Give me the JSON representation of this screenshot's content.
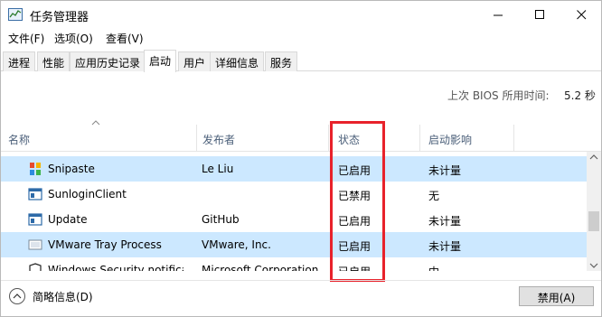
{
  "window": {
    "title": "任务管理器"
  },
  "menubar": [
    {
      "label": "文件(F)"
    },
    {
      "label": "选项(O)"
    },
    {
      "label": "查看(V)"
    }
  ],
  "tabs": [
    {
      "label": "进程"
    },
    {
      "label": "性能"
    },
    {
      "label": "应用历史记录"
    },
    {
      "label": "启动",
      "active": true
    },
    {
      "label": "用户"
    },
    {
      "label": "详细信息"
    },
    {
      "label": "服务"
    }
  ],
  "bios": {
    "label": "上次 BIOS 所用时间:",
    "value": "5.2 秒"
  },
  "columns": {
    "name": "名称",
    "publisher": "发布者",
    "status": "状态",
    "impact": "启动影响"
  },
  "rows": [
    {
      "name": "Snipaste",
      "publisher": "Le Liu",
      "status": "已启用",
      "impact": "未计量",
      "icon": "snipaste-icon",
      "selected": true
    },
    {
      "name": "SunloginClient",
      "publisher": "",
      "status": "已禁用",
      "impact": "无",
      "icon": "app-window-icon",
      "selected": false
    },
    {
      "name": "Update",
      "publisher": "GitHub",
      "status": "已启用",
      "impact": "未计量",
      "icon": "app-window-icon",
      "selected": false
    },
    {
      "name": "VMware Tray Process",
      "publisher": "VMware, Inc.",
      "status": "已启用",
      "impact": "未计量",
      "icon": "vmware-icon",
      "selected": true
    },
    {
      "name": "Windows Security notifica...",
      "publisher": "Microsoft Corporation",
      "status": "已启用",
      "impact": "中",
      "icon": "shield-icon",
      "selected": false
    }
  ],
  "bottom": {
    "fewer_details": "简略信息(D)",
    "disable_button": "禁用(A)"
  },
  "colors": {
    "selection": "#cce8ff",
    "highlight_box": "#e8222b",
    "header_text": "#4c607a"
  }
}
